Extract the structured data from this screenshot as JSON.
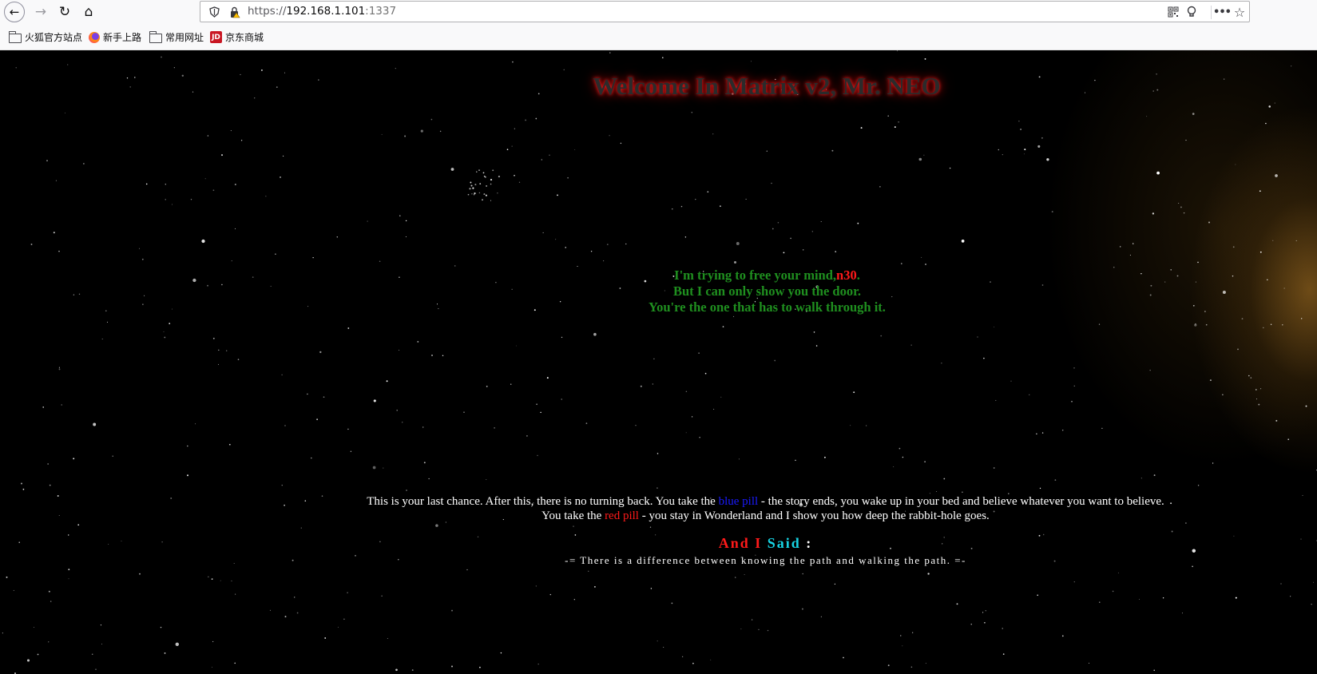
{
  "browser": {
    "url_scheme": "https://",
    "url_host": "192.168.1.101",
    "url_port": ":1337",
    "icons": {
      "back": "back-arrow-icon",
      "forward": "forward-arrow-icon",
      "reload": "reload-icon",
      "home": "home-icon",
      "shield": "tracking-shield-icon",
      "lock": "insecure-lock-icon",
      "qr": "qr-code-icon",
      "bulb": "lightbulb-icon",
      "more": "more-icon",
      "star": "bookmark-star-icon"
    }
  },
  "bookmarks": [
    {
      "label": "火狐官方站点",
      "icon": "folder-icon"
    },
    {
      "label": "新手上路",
      "icon": "firefox-icon"
    },
    {
      "label": "常用网址",
      "icon": "folder-icon"
    },
    {
      "label": "京东商城",
      "icon": "jd-icon",
      "icon_text": "JD"
    }
  ],
  "page": {
    "title": "Welcome In Matrix v2, Mr. NEO",
    "quote": {
      "line1_prefix": "I'm trying to free your mind,",
      "line1_name": "n30",
      "line1_suffix": ".",
      "line2": "But I can only show you the door.",
      "line3": "You're the one that has to walk through it."
    },
    "chance": {
      "line1_a": "This is your last chance. After this, there is no turning back. You take the ",
      "blue_pill": "blue pill",
      "line1_b": " - the story ends, you wake up in your bed and believe whatever you want to believe.",
      "line2_a": "You take the ",
      "red_pill": "red pill",
      "line2_b": " - you stay in Wonderland and I show you how deep the rabbit-hole goes."
    },
    "said": {
      "part1": "And I ",
      "part2": "Said",
      "part3": " :"
    },
    "motto": "-= There is a difference between knowing the path and walking the path. =-"
  },
  "colors": {
    "background": "#000000",
    "quote_green": "#1f8f1f",
    "accent_red": "#ff1a1a",
    "pill_blue": "#1a1aff",
    "said_cyan": "#17d4e4",
    "nebula": "#be8228"
  }
}
